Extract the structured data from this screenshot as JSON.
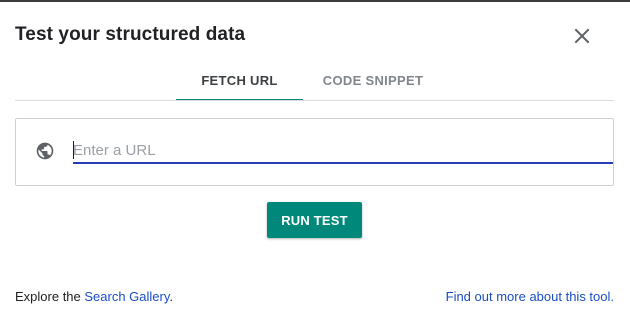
{
  "dialog": {
    "title": "Test your structured data"
  },
  "tabs": [
    {
      "label": "FETCH URL",
      "active": true
    },
    {
      "label": "CODE SNIPPET",
      "active": false
    }
  ],
  "url_field": {
    "placeholder": "Enter a URL",
    "value": "",
    "icon": "globe-icon"
  },
  "run_button": {
    "label": "RUN TEST"
  },
  "footer": {
    "explore_prefix": "Explore the ",
    "gallery_link": "Search Gallery",
    "gallery_suffix": ".",
    "more_link": "Find out more about this tool."
  },
  "colors": {
    "accent": "#00897b",
    "link": "#1a4fc9",
    "input_underline": "#2b3db5"
  }
}
